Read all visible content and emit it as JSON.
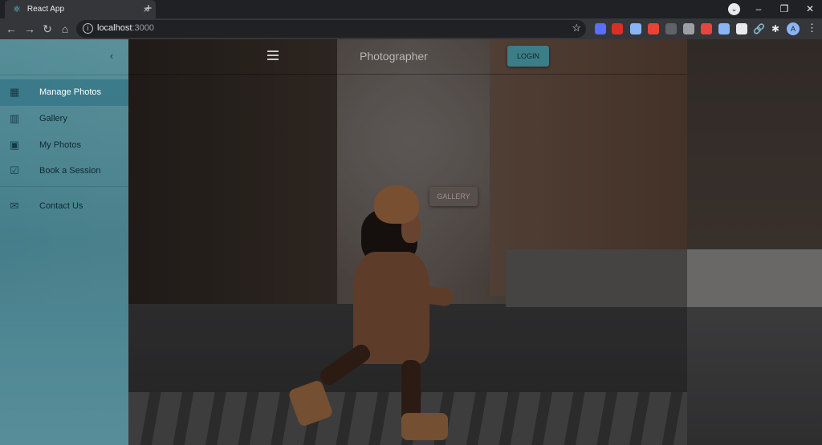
{
  "browser": {
    "tab_title": "React App",
    "url_host": "localhost",
    "url_port": ":3000",
    "avatar_initial": "A"
  },
  "icons": {
    "favicon": "react-icon",
    "close": "close-icon",
    "new_tab": "plus-icon",
    "back": "arrow-left-icon",
    "forward": "arrow-right-icon",
    "reload": "reload-icon",
    "home": "home-icon",
    "info": "info-icon",
    "bookmark": "star-icon",
    "extensions": "puzzle-icon",
    "menu": "more-vertical-icon"
  },
  "app": {
    "title": "Photographer",
    "login_label": "LOGIN",
    "gallery_label": "GALLERY",
    "accent_color": "#3c7e88"
  },
  "sidebar": {
    "collapse_icon": "chevron-left-icon",
    "items": [
      {
        "label": "Manage Photos",
        "icon": "dashboard-icon",
        "active": true
      },
      {
        "label": "Gallery",
        "icon": "film-icon",
        "active": false
      },
      {
        "label": "My Photos",
        "icon": "portrait-icon",
        "active": false
      },
      {
        "label": "Book a Session",
        "icon": "calendar-check-icon",
        "active": false
      },
      {
        "label": "Contact Us",
        "icon": "mail-icon",
        "active": false
      }
    ]
  }
}
